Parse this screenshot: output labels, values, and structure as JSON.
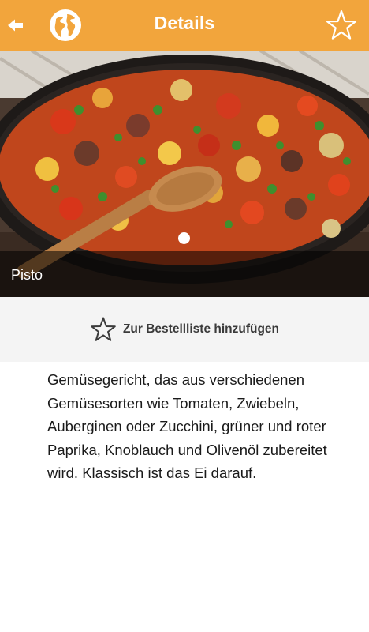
{
  "header": {
    "title": "Details",
    "back_icon": "arrow-left-icon",
    "globe_icon": "globe-icon",
    "favorite_icon": "star-outline-icon",
    "background_color": "#f2a53c"
  },
  "hero": {
    "caption": "Pisto",
    "carousel_index": 1,
    "carousel_count": 1
  },
  "order": {
    "label": "Zur Bestellliste hinzufügen",
    "icon": "star-outline-icon"
  },
  "description": {
    "text": "Gemüsegericht, das aus verschiedenen Gemüsesorten wie Tomaten, Zwiebeln, Auberginen oder Zucchini, grüner und roter Paprika, Knoblauch und Olivenöl zubereitet wird. Klassisch ist das Ei darauf."
  }
}
